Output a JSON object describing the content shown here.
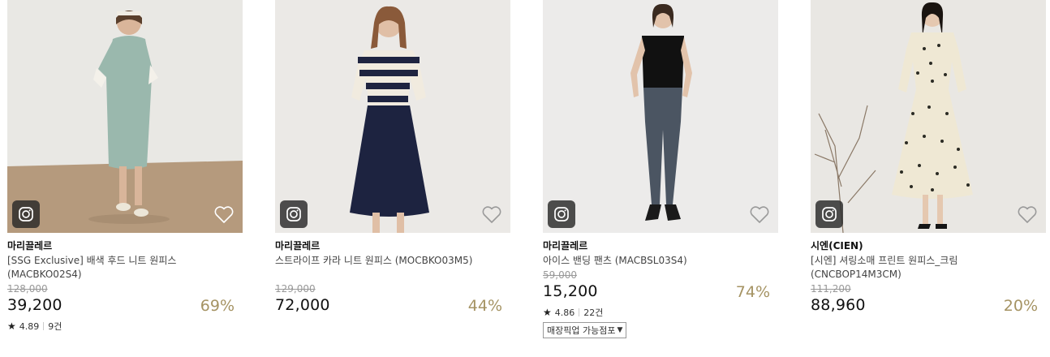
{
  "products": [
    {
      "brand": "마리끌레르",
      "name": "[SSG Exclusive] 배색 후드 니트 원피스 (MACBKO02S4)",
      "original_price": "128,000",
      "sale_price": "39,200",
      "discount": "69%",
      "rating": "4.89",
      "reviews": "9건",
      "pickup": null
    },
    {
      "brand": "마리끌레르",
      "name": "스트라이프 카라 니트 원피스 (MOCBKO03M5)",
      "original_price": "129,000",
      "sale_price": "72,000",
      "discount": "44%",
      "rating": null,
      "reviews": null,
      "pickup": null
    },
    {
      "brand": "마리끌레르",
      "name": "아이스 밴딩 팬츠 (MACBSL03S4)",
      "original_price": "59,000",
      "sale_price": "15,200",
      "discount": "74%",
      "rating": "4.86",
      "reviews": "22건",
      "pickup": "매장픽업 가능점포"
    },
    {
      "brand": "시엔(CIEN)",
      "name": "[시엔] 셔링소매 프린트 원피스_크림 (CNCBOP14M3CM)",
      "original_price": "111,200",
      "sale_price": "88,960",
      "discount": "20%",
      "rating": null,
      "reviews": null,
      "pickup": null
    }
  ],
  "icons": {
    "instagram": "instagram-icon",
    "wishlist": "heart-icon",
    "rating": "star-icon",
    "dropdown": "caret-down-icon"
  },
  "colors": {
    "discount": "#a59363",
    "strike": "#999999",
    "brand": "#111111"
  }
}
